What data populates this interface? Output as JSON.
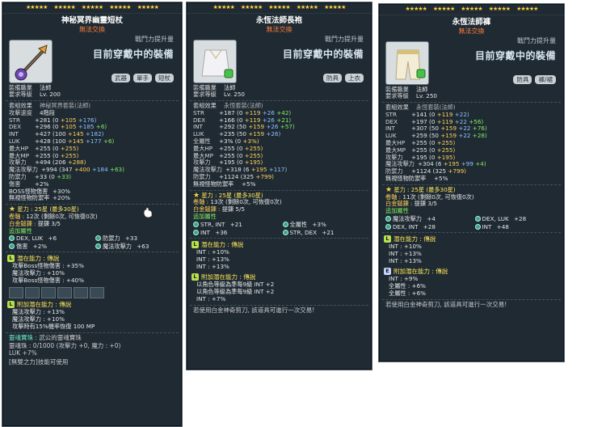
{
  "common": {
    "power_label": "戰鬥力提升量",
    "wearing_label": "目前穿戴中的裝備",
    "trade": "無法交換",
    "job_label": "裝備職業",
    "job": "法師",
    "level_label": "要求等級"
  },
  "p1": {
    "title": "神秘冥界幽靈短杖",
    "level": "Lv. 200",
    "tags": [
      "武器",
      "單手",
      "短杖"
    ],
    "rows": [
      {
        "k": "套組效果",
        "v": "神秘冥界套裝(法師)"
      },
      {
        "k": "攻擊速度",
        "v": "4階段"
      },
      {
        "k": "STR",
        "v": "+281 (0",
        "a": "+105",
        "b": "+176)"
      },
      {
        "k": "DEX",
        "v": "+296 (0",
        "a": "+105",
        "b": "+185",
        "c": "+6)"
      },
      {
        "k": "INT",
        "v": "+427 (100",
        "a": "+145",
        "b": "+182)"
      },
      {
        "k": "LUK",
        "v": "+428 (100",
        "a": "+145",
        "b": "+177",
        "c": "+6)"
      },
      {
        "k": "最大HP",
        "v": "+255 (0",
        "a": "+255)"
      },
      {
        "k": "最大MP",
        "v": "+255 (0",
        "a": "+255)"
      },
      {
        "k": "攻擊力",
        "v": "+494 (206",
        "a": "+288)"
      },
      {
        "k": "魔法攻擊力",
        "v": "+994 (347",
        "a": "+400",
        "b": "+184",
        "c": "+63)"
      },
      {
        "k": "防禦力",
        "v": "+33 (0",
        "a": "+33)"
      },
      {
        "k": "傷害",
        "v": "+2%"
      },
      {
        "k": "BOSS怪物傷害",
        "v": "+30%"
      },
      {
        "k": "無視怪物防禦率",
        "v": "+20%"
      }
    ],
    "star": "星力 : 25星 (最多30星)",
    "scroll_label": "卷軸 :",
    "scroll": "12次 (剩餘0次, 可恢復0次)",
    "hammer_label": "白金鎚鍊 :",
    "hammer": "提鍊 3/5",
    "add_label": "追加屬性",
    "add": [
      [
        "DEX, LUK",
        "+6"
      ],
      [
        "防禦力",
        "+33"
      ],
      [
        "傷害",
        "+2%"
      ],
      [
        "魔法攻擊力",
        "+63"
      ]
    ],
    "pot_label": "潛在能力 : 傳說",
    "pot": [
      "攻擊Boss怪物傷害 : +35%",
      "魔法攻擊力 : +10%",
      "攻擊Boss怪物傷害 : +40%"
    ],
    "apot_label": "附加潛在能力 : 傳說",
    "apot": [
      "魔法攻擊力 : +13%",
      "魔法攻擊力 : +10%",
      "攻擊時有15%機率恢復 100 MP"
    ],
    "soul_label": "靈魂寶珠 :",
    "soul": "武公的靈魂寶珠",
    "soul2": "靈魂珠 : 0/1000 (攻擊力 +0, 魔力 : +0)",
    "luk": "LUK +7%",
    "skill": "[無雙之力]技能可使用"
  },
  "p2": {
    "title": "永恆法師長袍",
    "level": "Lv. 250",
    "tags": [
      "防具",
      "上衣"
    ],
    "rows": [
      {
        "k": "套組效果",
        "v": "永恆套裝(法師)"
      },
      {
        "k": "STR",
        "v": "+187 (0",
        "a": "+119",
        "b": "+26",
        "c": "+42)"
      },
      {
        "k": "DEX",
        "v": "+166 (0",
        "a": "+119",
        "b": "+26",
        "c": "+21)"
      },
      {
        "k": "INT",
        "v": "+292 (50",
        "a": "+159",
        "b": "+26",
        "c": "+57)"
      },
      {
        "k": "LUK",
        "v": "+235 (50",
        "a": "+159",
        "b": "+26)"
      },
      {
        "k": "全屬性",
        "v": "+3% (0",
        "a": "+3%)"
      },
      {
        "k": "最大HP",
        "v": "+255 (0",
        "a": "+255)"
      },
      {
        "k": "最大MP",
        "v": "+255 (0",
        "a": "+255)"
      },
      {
        "k": "攻擊力",
        "v": "+195 (0",
        "a": "+195)"
      },
      {
        "k": "魔法攻擊力",
        "v": "+318 (6",
        "a": "+195",
        "b": "+117)"
      },
      {
        "k": "防禦力",
        "v": "+1124 (325",
        "a": "+799)"
      },
      {
        "k": "無視怪物防禦率",
        "v": "+5%"
      }
    ],
    "star": "星力 : 25星 (最多30星)",
    "scroll_label": "卷軸 :",
    "scroll": "13次 (剩餘0次, 可恢復0次)",
    "hammer_label": "白金鎚鍊 :",
    "hammer": "提鍊 5/5",
    "add_label": "追加屬性",
    "add": [
      [
        "STR, INT",
        "+21"
      ],
      [
        "全屬性",
        "+3%"
      ],
      [
        "INT",
        "+36"
      ],
      [
        "STR, DEX",
        "+21"
      ]
    ],
    "pot_label": "潛在能力 : 傳說",
    "pot": [
      "INT : +10%",
      "INT : +13%",
      "INT : +13%"
    ],
    "apot_label": "附加潛在能力 : 傳說",
    "apot": [
      "以角色等級為準每9級 INT +2",
      "以角色等級為準每9級 INT +2",
      "INT : +7%"
    ],
    "foot": "若使用白金神奇剪刀, 該道具可進行一次交易!"
  },
  "p3": {
    "title": "永恆法師褲",
    "level": "Lv. 250",
    "tags": [
      "防具",
      "褲/裙"
    ],
    "rows": [
      {
        "k": "套組效果",
        "v": "永恆套裝(法師)"
      },
      {
        "k": "STR",
        "v": "+141 (0",
        "a": "+119",
        "b": "+22)"
      },
      {
        "k": "DEX",
        "v": "+197 (0",
        "a": "+119",
        "b": "+22",
        "c": "+56)"
      },
      {
        "k": "INT",
        "v": "+307 (50",
        "a": "+159",
        "b": "+22",
        "c": "+76)"
      },
      {
        "k": "LUK",
        "v": "+259 (50",
        "a": "+159",
        "b": "+22",
        "c": "+28)"
      },
      {
        "k": "最大HP",
        "v": "+255 (0",
        "a": "+255)"
      },
      {
        "k": "最大MP",
        "v": "+255 (0",
        "a": "+255)"
      },
      {
        "k": "攻擊力",
        "v": "+195 (0",
        "a": "+195)"
      },
      {
        "k": "魔法攻擊力",
        "v": "+304 (6",
        "a": "+195",
        "b": "+99",
        "c": "+4)"
      },
      {
        "k": "防禦力",
        "v": "+1124 (325",
        "a": "+799)"
      },
      {
        "k": "無視怪物防禦率",
        "v": "+5%"
      }
    ],
    "star": "星力 : 25星 (最多30星)",
    "scroll_label": "卷軸 :",
    "scroll": "11次 (剩餘0次, 可恢復0次)",
    "hammer_label": "白金鎚鍊 :",
    "hammer": "提鍊 3/5",
    "add_label": "追加屬性",
    "add": [
      [
        "魔法攻擊力",
        "+4"
      ],
      [
        "DEX, LUK",
        "+28"
      ],
      [
        "DEX, INT",
        "+28"
      ],
      [
        "INT",
        "+48"
      ]
    ],
    "pot_label": "潛在能力 : 傳說",
    "pot": [
      "INT : +10%",
      "INT : +13%",
      "INT : +13%"
    ],
    "apot_label": "附加潛在能力 : 傳說",
    "apot": [
      "INT : +9%",
      "全屬性 : +6%",
      "全屬性 : +6%"
    ],
    "foot": "若使用白金神奇剪刀, 該道具可進行一次交易!"
  }
}
